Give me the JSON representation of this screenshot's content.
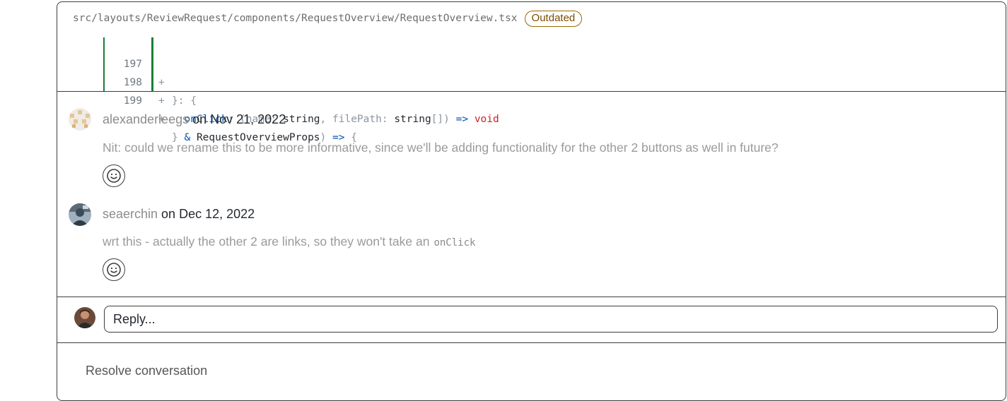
{
  "file": {
    "path": "src/layouts/ReviewRequest/components/RequestOverview/RequestOverview.tsx",
    "badge": "Outdated"
  },
  "code_lines": [
    {
      "number": "197",
      "sign": "+",
      "content": "}: {"
    },
    {
      "number": "198",
      "sign": "+",
      "content": "  onClick: (name: string, filePath: string[]) => void"
    },
    {
      "number": "199",
      "sign": "+",
      "content": "} & RequestOverviewProps) => {"
    }
  ],
  "comments": [
    {
      "author": "alexanderleegs",
      "date_prefix": " on ",
      "date": "Nov 21, 2022",
      "body": "Nit: could we rename this to be more informative, since we'll be adding functionality for the other 2 buttons as well in future?"
    },
    {
      "author": "seaerchin",
      "date_prefix": " on ",
      "date": "Dec 12, 2022",
      "body": "wrt this - actually the other 2 are links, so they won't take an",
      "code": "onClick"
    }
  ],
  "reply": {
    "placeholder": "Reply..."
  },
  "resolve": {
    "label": "Resolve conversation"
  },
  "colors": {
    "added_bar": "#1a7f37",
    "badge": "#9a6700",
    "border": "#3d3d3d"
  }
}
